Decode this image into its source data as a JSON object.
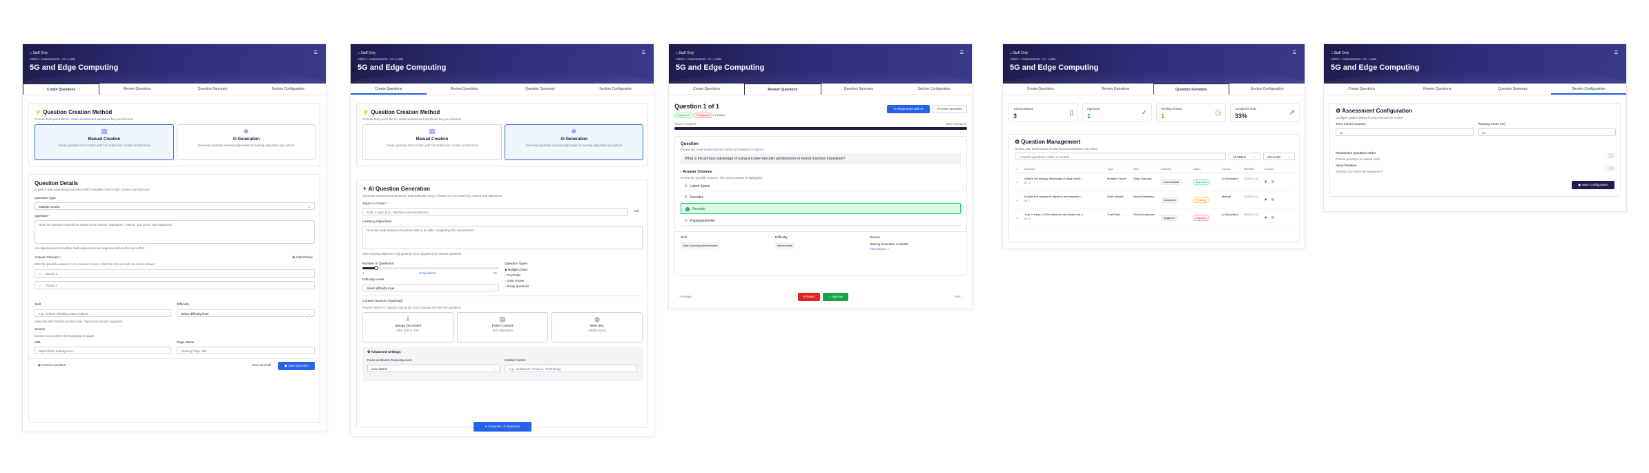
{
  "header": {
    "staff": "Staff Only",
    "crumb": "Admin  ›  Assessments  ›  AI  ›  LLMs",
    "title": "5G and Edge Computing",
    "menu": "☰"
  },
  "tabs": [
    "Create Questions",
    "Review Questions",
    "Question Summary",
    "Section Configuration"
  ],
  "p1": {
    "method_title": "Question Creation Method",
    "method_sub": "Choose how you'd like to create assessment questions for your learners",
    "manual_title": "Manual Creation",
    "manual_desc": "Create questions from scratch with full control over content and structure",
    "ai_title": "AI Generation",
    "ai_desc": "Generate questions automatically based on learning objectives and content",
    "details_title": "Question Details",
    "details_sub": "Create a new assessment question with complete control over content and structure",
    "qtype_label": "Question Type",
    "qtype_value": "Multiple Choice",
    "question_label": "Question *",
    "question_ph": "Write the question that will be asked to the learner. Markdown, GitHub, and LaTeX are supported.",
    "md_hint": "Use Markdown for formatting. Math expressions are supported with KaTeX and LaTeX.",
    "choices_label": "Answer Choices *",
    "add_choice": "Add Choice",
    "choices_hint": "Write the possible answers for the learner to select. Click the circle to mark the correct answer.",
    "choice1": "Choice 1",
    "choice2": "Choice 2",
    "skill_label": "Skill",
    "skill_ph": "e.g., Critical Thinking, Data Analysis",
    "skill_hint": "Select the skill that this question tests. Type ahead search supported.",
    "difficulty_label": "Difficulty",
    "difficulty_value": "Select difficulty level",
    "source_label": "Source",
    "source_hint": "Content source where the knowledge is taught",
    "url_label": "URL",
    "url_ph": "https://learn.udacity.com/...",
    "page_label": "Page Name",
    "page_ph": "Training Page Title",
    "preview": "Preview Question",
    "draft": "Save as Draft",
    "save": "Save Question"
  },
  "p2": {
    "method_title": "Question Creation Method",
    "method_sub": "Choose how you'd like to create assessment questions for your learners",
    "manual_title": "Manual Creation",
    "manual_desc": "Create questions from scratch with full control over content and structure",
    "ai_title": "AI Generation",
    "ai_desc": "Generate questions automatically based on learning objectives and content",
    "gen_title": "AI Question Generation",
    "gen_sub": "Generate assessment questions automatically using AI based on your learning content and objectives",
    "topics_label": "Topics to Cover *",
    "topics_ph": "Enter a topic (e.g., Machine Learning Basics)",
    "add": "Add",
    "objectives_label": "Learning Objectives",
    "objectives_ph": "Describe what learners should be able to do after completing this assessment...",
    "objectives_hint": "Clear learning objectives help generate more targeted and relevant questions.",
    "num_label": "Number of Questions",
    "num_min": "1",
    "num_val": "10 questions",
    "num_max": "50",
    "num_fraction": 0.1,
    "types_label": "Question Types",
    "types": [
      "Multiple Choice",
      "True/False",
      "Short Answer",
      "Essay Questions"
    ],
    "diff_label": "Difficulty Level",
    "diff_value": "Select difficulty level",
    "content_label": "Content Sources (Optional)",
    "content_hint": "Provide reference material to generate more accurate and relevant questions",
    "src1": "Upload Document",
    "src1_sub": "PDF, DOCX, TXT",
    "src2": "Paste Content",
    "src2_sub": "Text, Markdown",
    "src3": "Web URL",
    "src3_sub": "Articles, Docs",
    "adv_title": "Advanced Settings",
    "bloom_label": "Focus on Bloom's Taxonomy Level",
    "bloom_value": "Auto-detect",
    "industry_label": "Industry Context",
    "industry_ph": "e.g., Healthcare, Finance, Technology",
    "generate": "Generate 10 Questions"
  },
  "p3": {
    "qcount": "Question 1 of 1",
    "badge_approved": "0 Approved",
    "badge_rejected": "0 Rejected",
    "pending": "1 Pending",
    "regen": "Regenerate with AI",
    "preview": "Preview Question",
    "progress_label": "Review Progress",
    "progress_pct": "100% Complete",
    "progress_fraction": 1.0,
    "q_label": "Question",
    "q_hint": "Review this AI-generated question below and approve or reject it.",
    "q_text": "What is the primary advantage of using encoder-decoder architectures in neural machine translation?",
    "choices_title": "Answer Choices",
    "choices_hint": "Review the possible answers. The correct answer is highlighted.",
    "choices": [
      {
        "letter": "A",
        "text": "Latent Space"
      },
      {
        "letter": "B",
        "text": "Decoder"
      },
      {
        "letter": "C",
        "text": "Encoder"
      },
      {
        "letter": "D",
        "text": "Hyperparameter"
      }
    ],
    "skill_label": "Skill",
    "skill_value": "Deep Learning Architectures",
    "diff_label": "Difficulty",
    "diff_value": "Intermediate",
    "source_label": "Source",
    "source_value": "Training Generative AI Models",
    "source_link": "View Source ↗",
    "prev": "‹  Previous",
    "reject": "✕  Reject",
    "approve": "✓  Approve",
    "next": "Next  ›"
  },
  "p4": {
    "stats": [
      {
        "label": "Total Questions",
        "value": "3"
      },
      {
        "label": "Approved",
        "value": "1"
      },
      {
        "label": "Pending Review",
        "value": "1"
      },
      {
        "label": "Completion Rate",
        "value": "33%"
      }
    ],
    "mgmt_title": "Question Management",
    "mgmt_sub": "Review, edit, and manage all assessment questions in one place",
    "search_ph": "Search questions, skills, or content...",
    "status_filter": "All Status",
    "level_filter": "All Levels",
    "columns": [
      "Question",
      "Type",
      "Skill",
      "Difficulty",
      "Status",
      "Source",
      "Modified",
      "Actions"
    ],
    "rows": [
      {
        "q": "What is the primary advantage of using encod...",
        "id": "ID: 1",
        "type": "Multiple Choice",
        "skill": "Deep Learning",
        "diff": "Intermediate",
        "status": "Approved",
        "source": "AI Generated",
        "mod": "2024-01-15"
      },
      {
        "q": "Explain the concept of attention mechanisms i...",
        "id": "ID: 2",
        "type": "Short Answer",
        "skill": "Neural Networks",
        "diff": "Advanced",
        "status": "Pending",
        "source": "Manual",
        "mod": "2024-01-14"
      },
      {
        "q": "True or False: LSTM networks can handle the v...",
        "id": "ID: 3",
        "type": "True/False",
        "skill": "RNN Architecture",
        "diff": "Beginner",
        "status": "Rejected",
        "source": "AI Generated",
        "mod": "2024-01-13"
      }
    ]
  },
  "p5": {
    "title": "Assessment Configuration",
    "sub": "Configure global settings for this assessment section",
    "time_label": "Time Limit (minutes)",
    "time_value": "60",
    "pass_label": "Passing Score (%)",
    "pass_value": "80",
    "rand_label": "Randomize Question Order",
    "rand_hint": "Present questions in random order",
    "retake_label": "Allow Retakes",
    "retake_hint": "Students can retake the assessment",
    "save": "Save Configuration"
  },
  "colors": {
    "header": "#312e81",
    "primary": "#2563eb",
    "success": "#16a34a",
    "danger": "#dc2626",
    "warning": "#d97706"
  }
}
